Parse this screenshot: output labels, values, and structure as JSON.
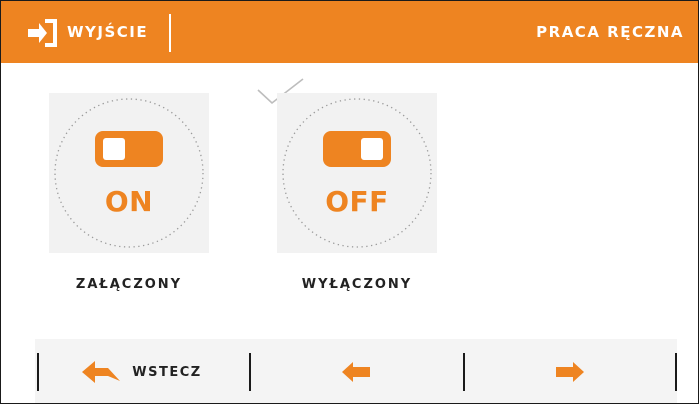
{
  "header": {
    "exit_label": "WYJŚCIE",
    "title": "PRACA RĘCZNA"
  },
  "options": [
    {
      "state": "ON",
      "label": "ZAŁĄCZONY",
      "icon": "toggle-on-icon"
    },
    {
      "state": "OFF",
      "label": "WYŁĄCZONY",
      "icon": "toggle-off-icon",
      "selected": true
    }
  ],
  "footer": {
    "back_label": "WSTECZ",
    "prev_icon": "arrow-left-icon",
    "next_icon": "arrow-right-icon"
  },
  "colors": {
    "accent": "#ee8421",
    "text": "#222222",
    "card_background": "#f2f2f2"
  }
}
